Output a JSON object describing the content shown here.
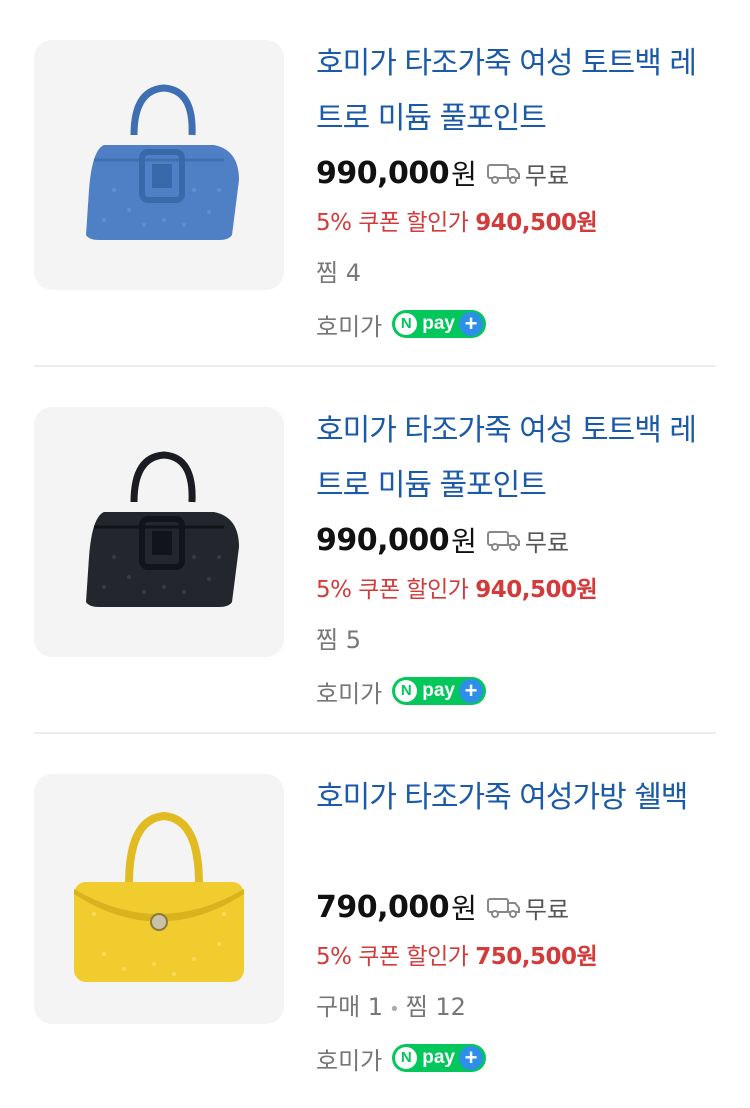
{
  "products": [
    {
      "title": "호미가 타조가죽 여성 토트백 레트로 미듐 풀포인트",
      "price": "990,000",
      "currency": "원",
      "shipping": "무료",
      "coupon_prefix": "5% 쿠폰 할인가 ",
      "coupon_price": "940,500원",
      "stats": "찜 4",
      "stat_purchase": "",
      "seller": "호미가",
      "npay_label": "pay",
      "bag_color": "#4f7fc4"
    },
    {
      "title": "호미가 타조가죽 여성 토트백 레트로 미듐 풀포인트",
      "price": "990,000",
      "currency": "원",
      "shipping": "무료",
      "coupon_prefix": "5% 쿠폰 할인가 ",
      "coupon_price": "940,500원",
      "stats": "찜 5",
      "stat_purchase": "",
      "seller": "호미가",
      "npay_label": "pay",
      "bag_color": "#23262d"
    },
    {
      "title": "호미가 타조가죽 여성가방 쉘백",
      "price": "790,000",
      "currency": "원",
      "shipping": "무료",
      "coupon_prefix": "5% 쿠폰 할인가 ",
      "coupon_price": "750,500원",
      "stats": "찜 12",
      "stat_purchase": "구매 1",
      "seller": "호미가",
      "npay_label": "pay",
      "bag_color": "#f0cc2e"
    }
  ],
  "colors": {
    "title": "#1b59a9",
    "coupon": "#d33a3a",
    "npay_green": "#03c75a",
    "npay_plus": "#2f8fe8"
  },
  "icons": {
    "shipping": "truck-icon",
    "pay_badge": "naver-pay-plus-icon"
  }
}
